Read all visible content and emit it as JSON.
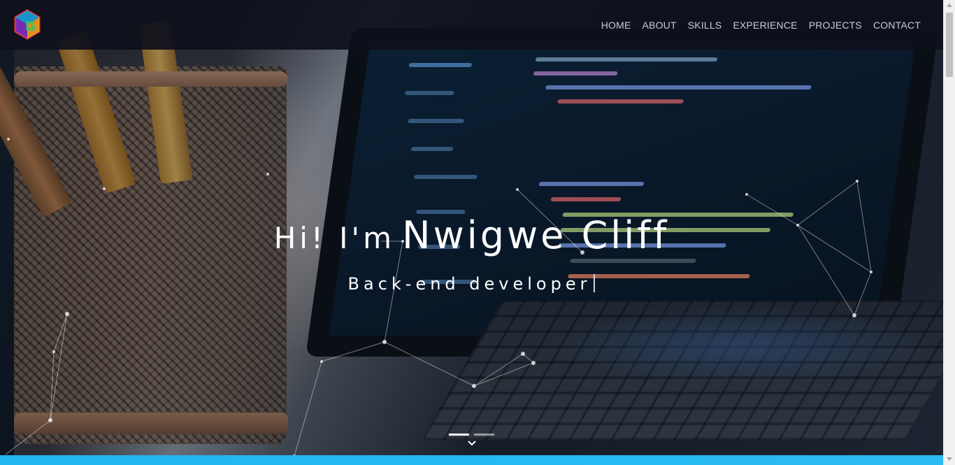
{
  "nav": {
    "items": [
      {
        "label": "HOME"
      },
      {
        "label": "ABOUT"
      },
      {
        "label": "SKILLS"
      },
      {
        "label": "EXPERIENCE"
      },
      {
        "label": "PROJECTS"
      },
      {
        "label": "CONTACT"
      }
    ]
  },
  "hero": {
    "greeting": "Hi! I'm",
    "name": "Nwigwe Cliff",
    "subtitle": "Back-end developer",
    "slides": {
      "count": 2,
      "active": 1
    }
  },
  "icons": {
    "logo": "logo-icon",
    "scroll": "chevron-down-icon"
  },
  "colors": {
    "navbar": "#0e101c",
    "nav_text": "#c9ccd3",
    "accent_bar": "#22b5f0",
    "hero_text": "#ffffff"
  }
}
